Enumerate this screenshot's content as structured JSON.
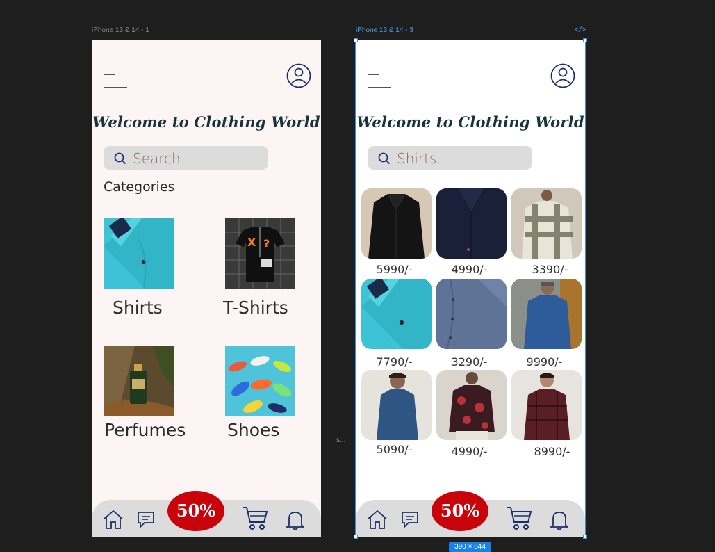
{
  "canvas": {
    "frame1_label": "iPhone 13 & 14 - 1",
    "frame2_label": "iPhone 13 & 14 - 3",
    "code_icon": "</>",
    "stray_label": "s...",
    "dimension_badge": "390 × 844"
  },
  "screen1": {
    "welcome": "Welcome to Clothing World",
    "search_placeholder": "Search",
    "categories_heading": "Categories",
    "categories": [
      {
        "label": "Shirts",
        "image": "turquoise-shirt-photo"
      },
      {
        "label": "T-Shirts",
        "image": "black-tshirt-photo"
      },
      {
        "label": "Perfumes",
        "image": "perfume-bottle-photo"
      },
      {
        "label": "Shoes",
        "image": "sneakers-photo"
      }
    ],
    "promo": "50%"
  },
  "screen2": {
    "welcome": "Welcome to Clothing World",
    "search_placeholder": "Shirts....",
    "products": [
      {
        "price": "5990/-",
        "image": "black-shirt-photo"
      },
      {
        "price": "4990/-",
        "image": "navy-shirt-photo"
      },
      {
        "price": "3390/-",
        "image": "checked-shirt-photo"
      },
      {
        "price": "7790/-",
        "image": "turquoise-shirt-photo"
      },
      {
        "price": "3290/-",
        "image": "grey-blue-shirt-photo"
      },
      {
        "price": "9990/-",
        "image": "denim-shirt-photo"
      },
      {
        "price": "5090/-",
        "image": "blue-shirt-model-photo"
      },
      {
        "price": "4990/-",
        "image": "floral-shirt-model-photo"
      },
      {
        "price": "8990/-",
        "image": "maroon-check-shirt-photo"
      }
    ],
    "promo": "50%"
  },
  "nav_icons": [
    "home-icon",
    "chat-icon",
    "cart-icon",
    "bell-icon"
  ],
  "colors": {
    "screen1_bg": "#fdf5f4",
    "promo_red": "#c8030a",
    "heading": "#17343c",
    "icon_navy": "#1d2e6b",
    "selection_blue": "#3b8ee0"
  }
}
